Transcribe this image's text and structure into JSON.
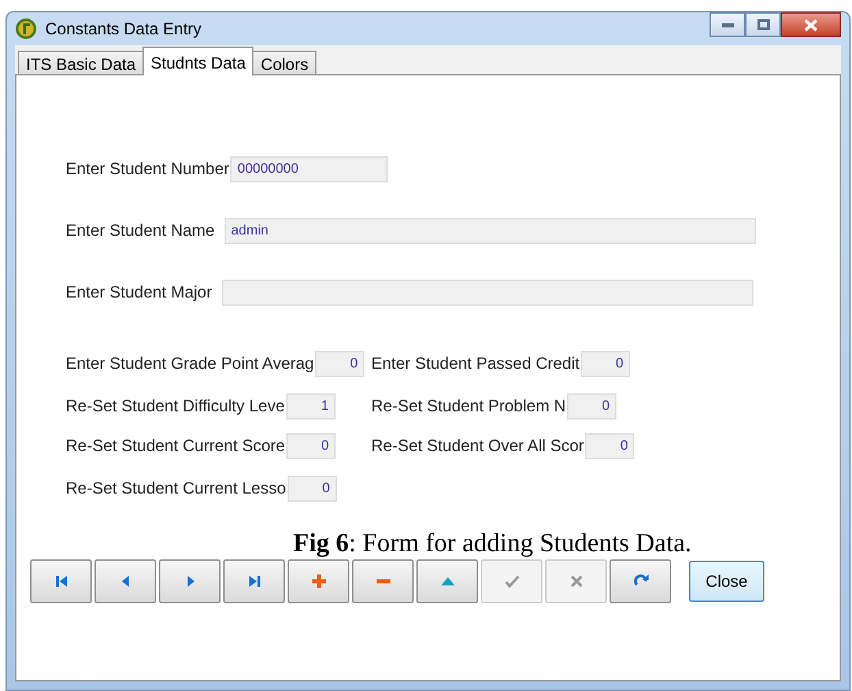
{
  "window": {
    "title": "Constants Data Entry"
  },
  "tabs": [
    {
      "label": "ITS Basic Data",
      "selected": false
    },
    {
      "label": "Studnts Data",
      "selected": true
    },
    {
      "label": "Colors",
      "selected": false
    }
  ],
  "wide_fields": [
    {
      "label": "Enter Student Number",
      "value": "00000000",
      "kind": "short"
    },
    {
      "label": "Enter Student Name",
      "value": "admin",
      "kind": "long"
    },
    {
      "label": "Enter Student Major",
      "kind": "long"
    }
  ],
  "small_field_rows": [
    [
      {
        "label": "Enter Student Grade Point Averag",
        "value": "0"
      },
      {
        "label": "Enter Student Passed Credit",
        "value": "0"
      }
    ],
    [
      {
        "label": "Re-Set Student Difficulty Leve",
        "value": "1"
      },
      {
        "label": "Re-Set Student Problem N",
        "value": "0"
      }
    ],
    [
      {
        "label": "Re-Set Student Current Score",
        "value": "0"
      },
      {
        "label": "Re-Set Student Over All Scor",
        "value": "0"
      }
    ],
    [
      {
        "label": "Re-Set Student Current Lesso",
        "value": "0"
      }
    ]
  ],
  "caption": "**Fig 6**: Form for adding Students Data.",
  "navigator": [
    {
      "kind": "first",
      "disabled": false
    },
    {
      "kind": "prior",
      "disabled": false
    },
    {
      "kind": "next",
      "disabled": false
    },
    {
      "kind": "last",
      "disabled": false
    },
    {
      "kind": "insert",
      "disabled": false
    },
    {
      "kind": "delete",
      "disabled": false
    },
    {
      "kind": "edit",
      "disabled": false
    },
    {
      "kind": "post",
      "disabled": true
    },
    {
      "kind": "cancel",
      "disabled": true
    },
    {
      "kind": "refresh",
      "disabled": false
    }
  ],
  "close_button": {
    "label": "Close"
  }
}
